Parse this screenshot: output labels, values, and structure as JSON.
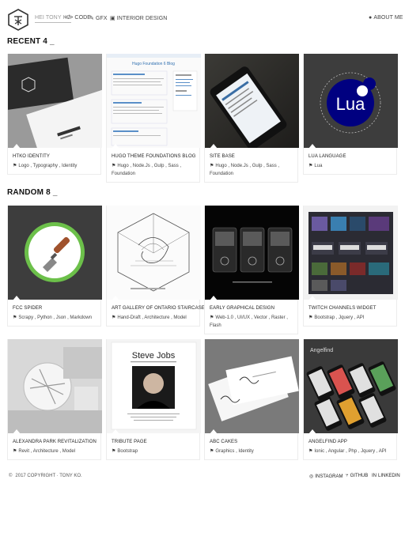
{
  "nav": {
    "items": [
      {
        "label": "HEI TONY KO",
        "icon": ""
      },
      {
        "label": "CODE",
        "icon": "</>"
      },
      {
        "label": "GFX",
        "icon": "✎"
      },
      {
        "label": "INTERIOR DESIGN",
        "icon": "▣"
      }
    ],
    "about": {
      "label": "ABOUT ME",
      "icon": "●"
    }
  },
  "sections": {
    "recent": {
      "title": "RECENT 4 _"
    },
    "random": {
      "title": "RANDOM 8 _"
    }
  },
  "cards": {
    "recent": [
      {
        "title": "HTKO IDENTITY",
        "tags": "Logo , Typography , Identity"
      },
      {
        "title": "HUGO THEME FOUNDATIONS BLOG",
        "tags": "Hugo , Node.Js , Gulp , Sass , Foundation"
      },
      {
        "title": "SITE BASE",
        "tags": "Hugo , Node.Js , Gulp , Sass , Foundation"
      },
      {
        "title": "LUA LANGUAGE",
        "tags": "Lua"
      }
    ],
    "random": [
      {
        "title": "FCC SPIDER",
        "tags": "Scrapy , Python , Json , Markdown"
      },
      {
        "title": "ART GALLERY OF ONTARIO STAIRCASE",
        "tags": "Hand-Draft , Architecture , Model"
      },
      {
        "title": "EARLY GRAPHICAL DESIGN",
        "tags": "Web-1.0 , UI/UX , Vector , Raster , Flash"
      },
      {
        "title": "TWITCH CHANNELS WIDGET",
        "tags": "Bootstrap , Jquery , API"
      },
      {
        "title": "ALEXANDRA PARK REVITALIZATION",
        "tags": "Revit , Architecture , Model"
      },
      {
        "title": "TRIBUTE PAGE",
        "tags": "Bootstrap"
      },
      {
        "title": "ABC CAKES",
        "tags": "Graphics , Identity"
      },
      {
        "title": "ANGELFIND APP",
        "tags": "Ionic , Angular , Php , Jquery , API"
      }
    ]
  },
  "thumb_text": {
    "hugo": "Hugo Foundation 6 Blog",
    "lua": "Lua",
    "steve": "Steve Jobs",
    "angelfind": "Angelfind"
  },
  "footer": {
    "copyright_icon": "©",
    "copyright": "2017 COPYRIGHT · TONY KO.",
    "links": [
      {
        "label": "INSTAGRAM",
        "icon": "◎"
      },
      {
        "label": "GITHUB",
        "icon": "⑂"
      },
      {
        "label": "LINKEDIN",
        "icon": "in"
      }
    ]
  },
  "colors": {
    "accent_green": "#6cc04a",
    "lua_blue": "#000080",
    "dark_thumb": "#3a3a3a"
  }
}
